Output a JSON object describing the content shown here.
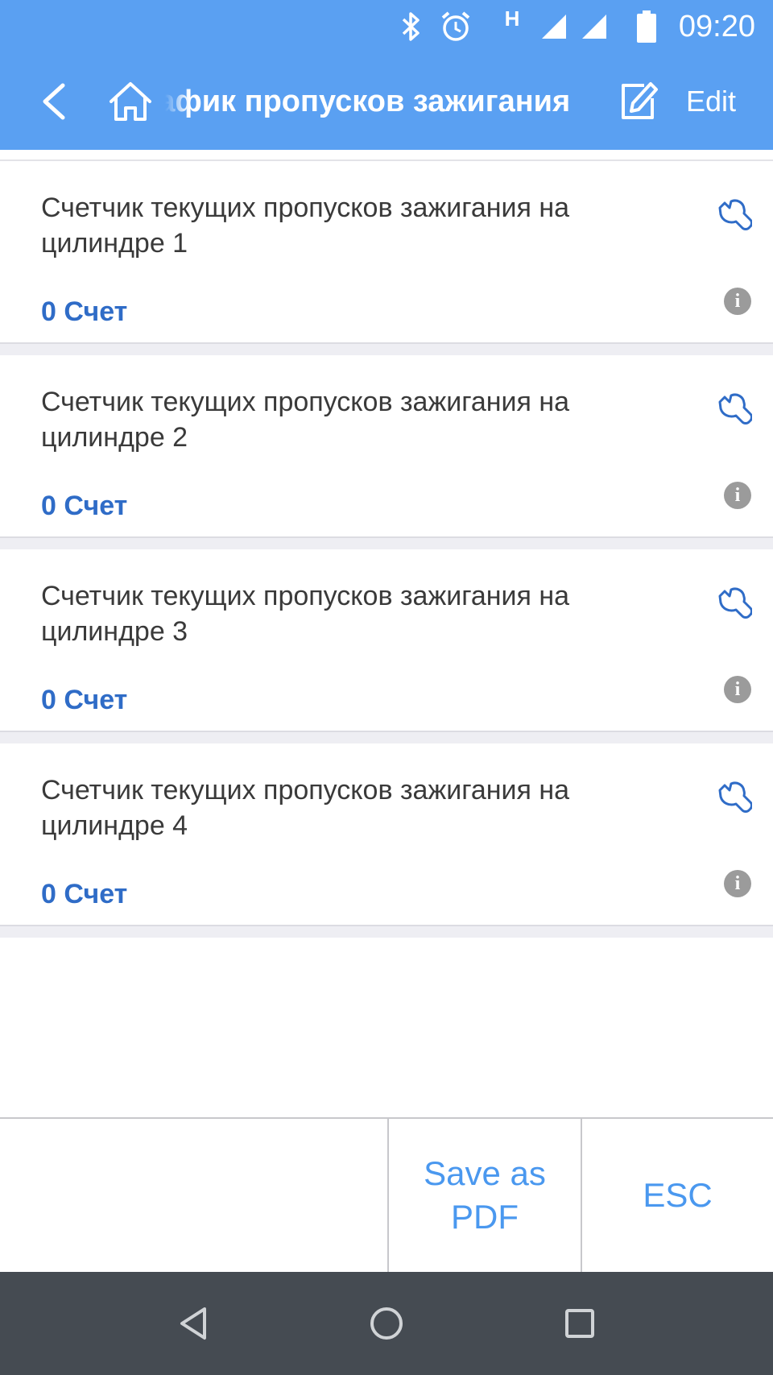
{
  "status_bar": {
    "time": "09:20",
    "network_type": "H",
    "icons": [
      "bluetooth-icon",
      "alarm-icon",
      "signal-icon",
      "signal-icon",
      "battery-icon"
    ]
  },
  "app_bar": {
    "title": "График пропусков зажигания",
    "edit_label": "Edit",
    "icons": [
      "back-arrow-icon",
      "home-icon",
      "edit-icon"
    ],
    "color": "#5aa0f2"
  },
  "items": [
    {
      "name": "Счетчик текущих пропусков зажигания на цилиндре 1",
      "value": "0 Счет"
    },
    {
      "name": "Счетчик текущих пропусков зажигания на цилиндре 2",
      "value": "0 Счет"
    },
    {
      "name": "Счетчик текущих пропусков зажигания на цилиндре 3",
      "value": "0 Счет"
    },
    {
      "name": "Счетчик текущих пропусков зажигания на цилиндре 4",
      "value": "0 Счет"
    }
  ],
  "item_icons": [
    "wrench-icon",
    "info-icon"
  ],
  "item_info_glyph": "i",
  "bottom_bar": {
    "save_pdf_label": "Save as PDF",
    "esc_label": "ESC",
    "accent": "#4a98ef"
  },
  "nav_bar": {
    "icons": [
      "nav-back-icon",
      "nav-home-icon",
      "nav-recents-icon"
    ]
  }
}
